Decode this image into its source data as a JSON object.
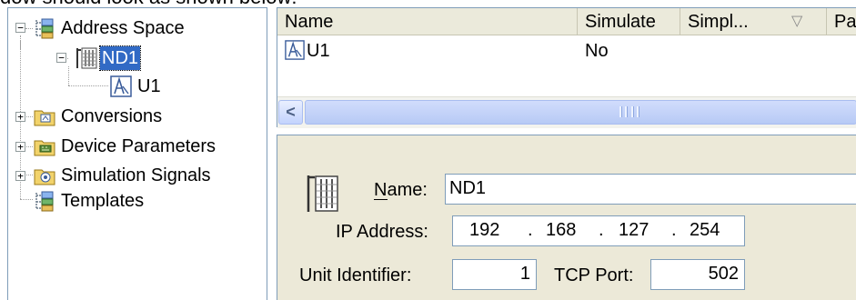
{
  "caption": "dow should look as shown below:",
  "tree": {
    "items": [
      {
        "label": "Address Space",
        "icon": "address-space-icon",
        "expander": "−"
      },
      {
        "label": "ND1",
        "icon": "network-device-icon",
        "expander": "−",
        "selected": true
      },
      {
        "label": "U1",
        "icon": "unit-icon"
      },
      {
        "label": "Conversions",
        "icon": "folder-conversions-icon",
        "expander": "+"
      },
      {
        "label": "Device Parameters",
        "icon": "folder-device-parameters-icon",
        "expander": "+"
      },
      {
        "label": "Simulation Signals",
        "icon": "folder-simulation-signals-icon",
        "expander": "+"
      },
      {
        "label": "Templates",
        "icon": "templates-icon"
      }
    ]
  },
  "list": {
    "columns": [
      "Name",
      "Simulate",
      "Simpl...",
      "Pa"
    ],
    "sort_glyph": "▽",
    "rows": [
      {
        "name": "U1",
        "simulate": "No"
      }
    ],
    "scroll_left_glyph": "<"
  },
  "properties": {
    "icon": "network-device-icon",
    "name_label": "Name:",
    "name_value": "ND1",
    "ip_label": "IP Address:",
    "ip_octets": [
      "192",
      "168",
      "127",
      "254"
    ],
    "ip_sep": ".",
    "unit_label": "Unit Identifier:",
    "unit_value": "1",
    "port_label": "TCP Port:",
    "port_value": "502"
  },
  "colors": {
    "selection": "#316ac5",
    "panel_bg": "#ece9d8",
    "header_bg": "#ebeadb",
    "border": "#7f9db9"
  }
}
